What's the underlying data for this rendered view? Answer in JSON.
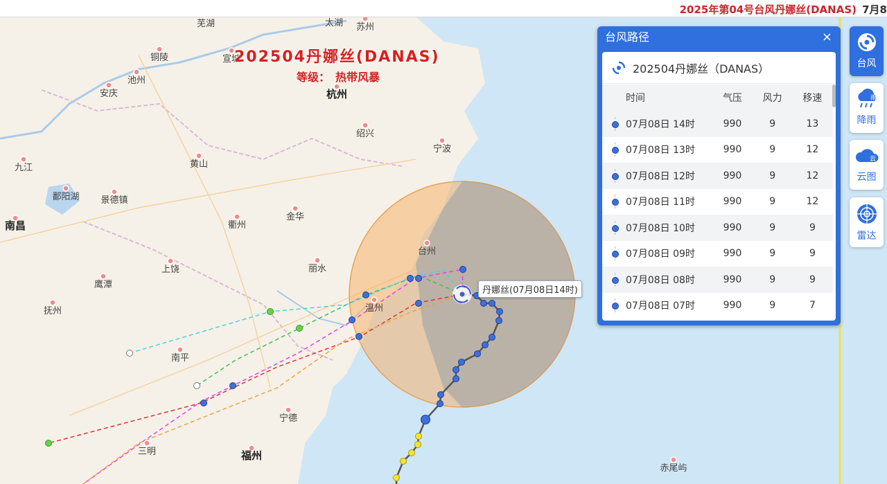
{
  "header": {
    "title": "2025年第04号台风丹娜丝(DANAS)",
    "date": "7月8"
  },
  "storm": {
    "title": "202504丹娜丝(DANAS)",
    "level_label": "等级：",
    "level_value": "热带风暴",
    "eye_label": "丹娜丝(07月08日14时)"
  },
  "cities": [
    "芜湖",
    "苏州",
    "太湖",
    "铜陵",
    "宣城",
    "安庆",
    "池州",
    "杭州",
    "绍兴",
    "宁波",
    "九江",
    "黄山",
    "鄱阳湖",
    "景德镇",
    "南昌",
    "衢州",
    "金华",
    "台州",
    "上饶",
    "鹰潭",
    "丽水",
    "抚州",
    "温州",
    "南平",
    "宁德",
    "三明",
    "福州",
    "赤尾屿"
  ],
  "panel": {
    "title": "台风路径",
    "close": "×",
    "storm_name": "202504丹娜丝（DANAS）",
    "columns": [
      "时间",
      "气压",
      "风力",
      "移速"
    ],
    "rows": [
      {
        "time": "07月08日 14时",
        "pressure": "990",
        "wind": "9",
        "speed": "13"
      },
      {
        "time": "07月08日 13时",
        "pressure": "990",
        "wind": "9",
        "speed": "12"
      },
      {
        "time": "07月08日 12时",
        "pressure": "990",
        "wind": "9",
        "speed": "12"
      },
      {
        "time": "07月08日 11时",
        "pressure": "990",
        "wind": "9",
        "speed": "12"
      },
      {
        "time": "07月08日 10时",
        "pressure": "990",
        "wind": "9",
        "speed": "9"
      },
      {
        "time": "07月08日 09时",
        "pressure": "990",
        "wind": "9",
        "speed": "9"
      },
      {
        "time": "07月08日 08时",
        "pressure": "990",
        "wind": "9",
        "speed": "9"
      },
      {
        "time": "07月08日 07时",
        "pressure": "990",
        "wind": "9",
        "speed": "7"
      }
    ]
  },
  "side_buttons": [
    {
      "label": "台风",
      "icon": "typhoon-icon"
    },
    {
      "label": "降雨",
      "icon": "rain-icon",
      "badge": "雨"
    },
    {
      "label": "云图",
      "icon": "cloud-icon",
      "badge": "云"
    },
    {
      "label": "雷达",
      "icon": "radar-icon"
    }
  ],
  "colors": {
    "accent": "#2f6fde",
    "title_red": "#d61f1f",
    "wind_circle": "#f5b26b"
  }
}
